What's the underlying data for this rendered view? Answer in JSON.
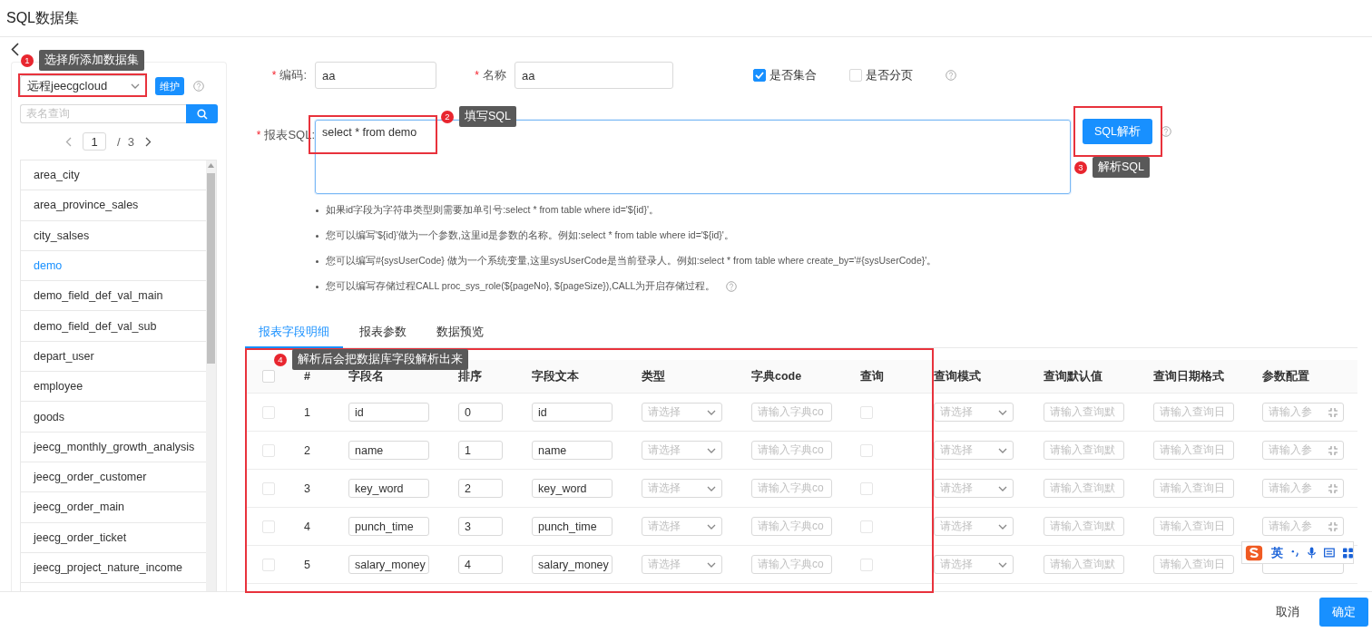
{
  "dialog": {
    "title": "SQL数据集"
  },
  "left": {
    "source": "远程jeecgcloud",
    "maintain_button": "维护",
    "search_placeholder": "表名查询",
    "pager": {
      "current": "1",
      "separator": "/",
      "total": "3"
    },
    "tables": [
      {
        "name": "area_city",
        "selected": false
      },
      {
        "name": "area_province_sales",
        "selected": false
      },
      {
        "name": "city_salses",
        "selected": false
      },
      {
        "name": "demo",
        "selected": true
      },
      {
        "name": "demo_field_def_val_main",
        "selected": false
      },
      {
        "name": "demo_field_def_val_sub",
        "selected": false
      },
      {
        "name": "depart_user",
        "selected": false
      },
      {
        "name": "employee",
        "selected": false
      },
      {
        "name": "goods",
        "selected": false
      },
      {
        "name": "jeecg_monthly_growth_analysis",
        "selected": false
      },
      {
        "name": "jeecg_order_customer",
        "selected": false
      },
      {
        "name": "jeecg_order_main",
        "selected": false
      },
      {
        "name": "jeecg_order_ticket",
        "selected": false
      },
      {
        "name": "jeecg_project_nature_income",
        "selected": false
      }
    ]
  },
  "form": {
    "code": {
      "required_mark": "*",
      "label": "编码:",
      "value": "aa"
    },
    "name": {
      "required_mark": "*",
      "label": "名称",
      "value": "aa"
    },
    "options": [
      {
        "label": "是否集合",
        "checked": true
      },
      {
        "label": "是否分页",
        "checked": false
      }
    ],
    "sql": {
      "required_mark": "*",
      "label": "报表SQL:",
      "value": "select *  from demo"
    },
    "parse_button": "SQL解析",
    "hints": [
      "如果id字段为字符串类型则需要加单引号:select * from table where id='${id}'。",
      "您可以编写'${id}'做为一个参数,这里id是参数的名称。例如:select * from table where id='${id}'。",
      "您可以编写#{sysUserCode} 做为一个系统变量,这里sysUserCode是当前登录人。例如:select * from table where create_by='#{sysUserCode}'。",
      "您可以编写存储过程CALL proc_sys_role(${pageNo}, ${pageSize}),CALL为开启存储过程。"
    ]
  },
  "tabs": [
    {
      "label": "报表字段明细",
      "selected": true
    },
    {
      "label": "报表参数",
      "selected": false
    },
    {
      "label": "数据预览",
      "selected": false
    }
  ],
  "table": {
    "header_checked": false,
    "columns": [
      "#",
      "字段名",
      "排序",
      "字段文本",
      "类型",
      "字典code",
      "查询",
      "查询模式",
      "查询默认值",
      "查询日期格式",
      "参数配置"
    ],
    "rows": [
      {
        "checked": false,
        "index": "1",
        "field_name": "id",
        "order": "0",
        "field_text": "id",
        "type_placeholder": "请选择",
        "dict_placeholder": "请输入字典co",
        "query_checked": false,
        "mode_placeholder": "请选择",
        "default_placeholder": "请输入查询默",
        "date_placeholder": "请输入查询日",
        "param_placeholder": "请输入参"
      },
      {
        "checked": false,
        "index": "2",
        "field_name": "name",
        "order": "1",
        "field_text": "name",
        "type_placeholder": "请选择",
        "dict_placeholder": "请输入字典co",
        "query_checked": false,
        "mode_placeholder": "请选择",
        "default_placeholder": "请输入查询默",
        "date_placeholder": "请输入查询日",
        "param_placeholder": "请输入参"
      },
      {
        "checked": false,
        "index": "3",
        "field_name": "key_word",
        "order": "2",
        "field_text": "key_word",
        "type_placeholder": "请选择",
        "dict_placeholder": "请输入字典co",
        "query_checked": false,
        "mode_placeholder": "请选择",
        "default_placeholder": "请输入查询默",
        "date_placeholder": "请输入查询日",
        "param_placeholder": "请输入参"
      },
      {
        "checked": false,
        "index": "4",
        "field_name": "punch_time",
        "order": "3",
        "field_text": "punch_time",
        "type_placeholder": "请选择",
        "dict_placeholder": "请输入字典co",
        "query_checked": false,
        "mode_placeholder": "请选择",
        "default_placeholder": "请输入查询默",
        "date_placeholder": "请输入查询日",
        "param_placeholder": "请输入参"
      },
      {
        "checked": false,
        "index": "5",
        "field_name": "salary_money",
        "order": "4",
        "field_text": "salary_money",
        "type_placeholder": "请选择",
        "dict_placeholder": "请输入字典co",
        "query_checked": false,
        "mode_placeholder": "请选择",
        "default_placeholder": "请输入查询默",
        "date_placeholder": "请输入查询日"
      }
    ]
  },
  "footer": {
    "cancel": "取消",
    "ok": "确定"
  },
  "annotations": [
    {
      "number": "1",
      "text": "选择所添加数据集"
    },
    {
      "number": "2",
      "text": "填写SQL"
    },
    {
      "number": "3",
      "text": "解析SQL"
    },
    {
      "number": "4",
      "text": "解析后会把数据库字段解析出来"
    }
  ],
  "ime": {
    "mode": "英"
  }
}
